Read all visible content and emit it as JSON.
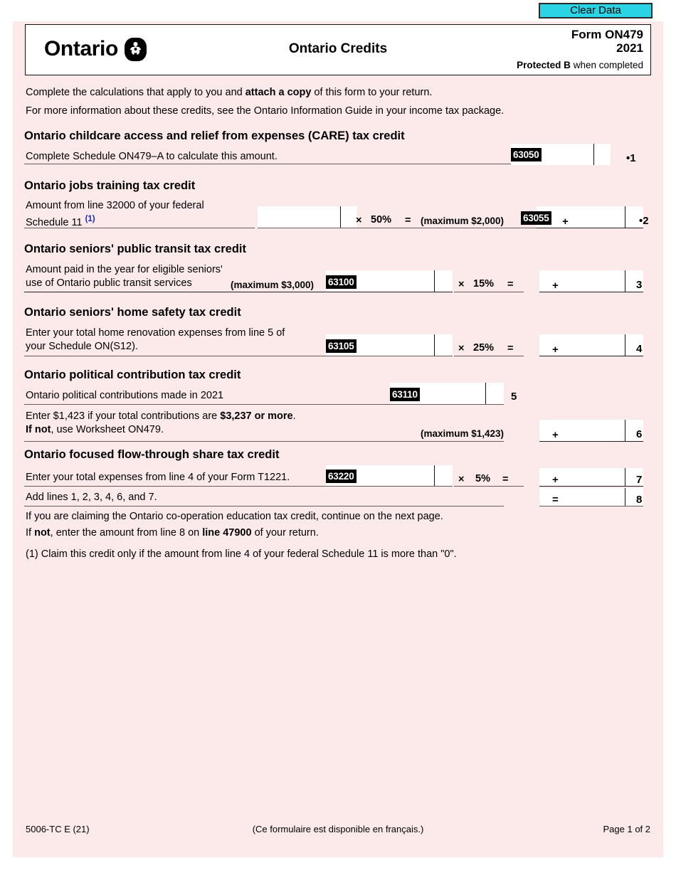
{
  "toolbar": {
    "clear_data_label": "Clear Data"
  },
  "header": {
    "wordmark": "Ontario",
    "logo_icon": "ontario-trillium-icon",
    "title": "Ontario Credits",
    "form_number": "Form ON479",
    "year": "2021",
    "protected_bold": "Protected B",
    "protected_rest": " when completed"
  },
  "intro": {
    "line1_a": "Complete the calculations that apply to you and ",
    "line1_b": "attach a copy",
    "line1_c": " of this form to your return.",
    "line2": "For more information about these credits, see the Ontario Information Guide in your income tax package."
  },
  "sections": {
    "care": {
      "heading": "Ontario childcare access and relief from expenses (CARE) tax credit",
      "label": "Complete Schedule ON479–A to calculate this amount.",
      "code": "63050",
      "value": "",
      "cents": "",
      "line_no": "1",
      "bullet": "•"
    },
    "jobs": {
      "heading": "Ontario jobs training tax credit",
      "label_l1": "Amount from line 32000 of your federal",
      "label_l2": "Schedule 11 ",
      "footnote_ref": "(1)",
      "base_value": "",
      "base_cents": "",
      "mult_op": "×",
      "rate": "50%",
      "eq": "=",
      "maximum": "(maximum $2,000)",
      "code": "63055",
      "plus": "+",
      "value": "",
      "cents": "",
      "line_no": "2",
      "bullet": "•"
    },
    "transit": {
      "heading": "Ontario seniors' public transit tax credit",
      "label_l1": "Amount paid in the year for eligible seniors'",
      "label_l2": "use of Ontario public transit services",
      "maximum": "(maximum $3,000)",
      "code": "63100",
      "base_value": "",
      "base_cents": "",
      "mult_op": "×",
      "rate": "15%",
      "eq": "=",
      "plus": "+",
      "value": "",
      "cents": "",
      "line_no": "3"
    },
    "home_safety": {
      "heading": "Ontario seniors' home safety tax credit",
      "label_l1": "Enter your total home renovation expenses from line 5 of",
      "label_l2": "your Schedule ON(S12).",
      "code": "63105",
      "base_value": "",
      "base_cents": "",
      "mult_op": "×",
      "rate": "25%",
      "eq": "=",
      "plus": "+",
      "value": "",
      "cents": "",
      "line_no": "4"
    },
    "political": {
      "heading": "Ontario political contribution tax credit",
      "label": "Ontario political contributions made in 2021",
      "code": "63110",
      "contrib_value": "",
      "contrib_cents": "",
      "line_no_5": "5",
      "worksheet_l1_a": "Enter $1,423 if your total contributions are ",
      "worksheet_l1_b": "$3,237 or more",
      "worksheet_l1_c": ".",
      "worksheet_l2_a": "If not",
      "worksheet_l2_b": ", use Worksheet ON479.",
      "maximum": "(maximum $1,423)",
      "plus": "+",
      "value": "",
      "cents": "",
      "line_no_6": "6"
    },
    "flow_through": {
      "heading": "Ontario focused flow-through share tax credit",
      "label": "Enter your total expenses from line 4 of your Form T1221.",
      "code": "63220",
      "base_value": "",
      "base_cents": "",
      "mult_op": "×",
      "rate": "5%",
      "eq": "=",
      "plus": "+",
      "value": "",
      "cents": "",
      "line_no": "7"
    },
    "total": {
      "label": "Add lines 1, 2, 3, 4, 6, and 7.",
      "equals": "=",
      "value": "",
      "cents": "",
      "line_no": "8"
    }
  },
  "closing": {
    "line1": "If you are claiming the Ontario co-operation education tax credit, continue on the next page.",
    "line2_a": "If ",
    "line2_b": "not",
    "line2_c": ", enter the amount from line 8 on ",
    "line2_d": "line 47900",
    "line2_e": " of your return.",
    "footnote": "(1) Claim this credit only if the amount from line 4 of your federal Schedule 11 is more than \"0\"."
  },
  "footer": {
    "form_code": "5006-TC E (21)",
    "french_note": "(Ce formulaire est disponible en français.)",
    "page": "Page 1 of 2"
  },
  "colors": {
    "page_background": "#fce9e9",
    "clear_button": "#2ad4e4",
    "footnote_ref": "#1a23c8",
    "code_tag_background": "#000000"
  }
}
